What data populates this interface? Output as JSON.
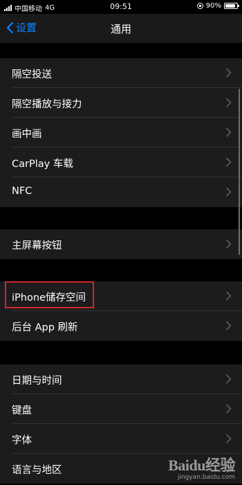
{
  "status_bar": {
    "carrier": "中国移动",
    "network": "4G",
    "time": "09:51",
    "battery_percent": "90%",
    "battery_level": 0.9
  },
  "nav": {
    "back_label": "设置",
    "title": "通用"
  },
  "groups": [
    {
      "items": [
        {
          "label": "隔空投送"
        },
        {
          "label": "隔空播放与接力"
        },
        {
          "label": "画中画"
        },
        {
          "label": "CarPlay 车载"
        },
        {
          "label": "NFC"
        }
      ]
    },
    {
      "items": [
        {
          "label": "主屏幕按钮"
        }
      ]
    },
    {
      "items": [
        {
          "label": "iPhone储存空间"
        },
        {
          "label": "后台 App 刷新"
        }
      ]
    },
    {
      "items": [
        {
          "label": "日期与时间"
        },
        {
          "label": "键盘"
        },
        {
          "label": "字体"
        },
        {
          "label": "语言与地区"
        }
      ]
    }
  ],
  "watermark": {
    "logo": "Baidu经验",
    "url": "jingyan.baidu.com"
  },
  "colors": {
    "accent": "#0a84ff",
    "background": "#000000",
    "cell": "#1c1c1e",
    "highlight": "#d0272a"
  }
}
